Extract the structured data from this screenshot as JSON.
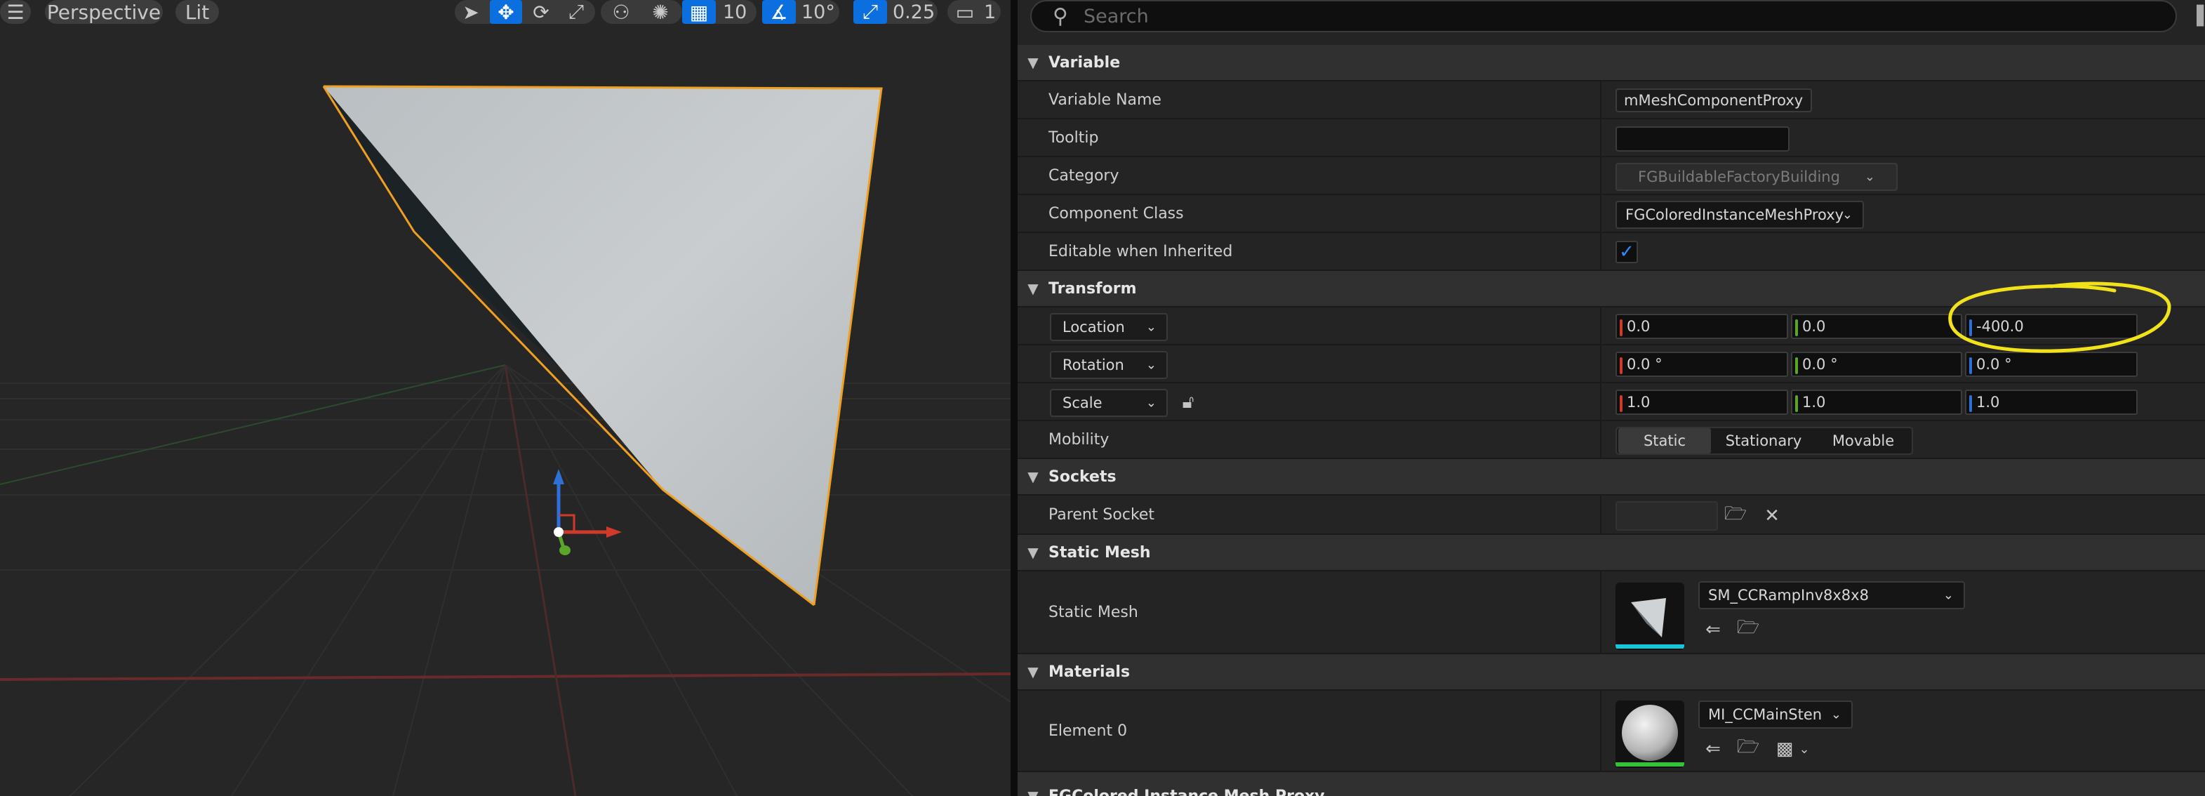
{
  "viewport": {
    "view_mode": "Perspective",
    "lighting_mode": "Lit",
    "grid_snap_value": "10",
    "angle_snap_value": "10°",
    "scale_snap_value": "0.25",
    "camera_speed": "1",
    "icons": [
      "hamburger-menu-icon",
      "select-mode-icon",
      "translate-mode-icon",
      "rotate-mode-icon",
      "scale-mode-icon",
      "surface-snap-icon",
      "world-local-icon",
      "grid-snap-icon",
      "angle-snap-icon",
      "scale-snap-icon",
      "camera-speed-icon"
    ]
  },
  "details": {
    "search_placeholder": "Search",
    "categories": {
      "variable": "Variable",
      "transform": "Transform",
      "sockets": "Sockets",
      "static_mesh": "Static Mesh",
      "materials": "Materials",
      "next": "FGColored Instance Mesh Proxy"
    },
    "variable_name_label": "Variable Name",
    "variable_name_value": "mMeshComponentProxy",
    "tooltip_label": "Tooltip",
    "tooltip_value": "",
    "category_label": "Category",
    "category_value": "FGBuildableFactoryBuilding",
    "component_class_label": "Component Class",
    "component_class_value": "FGColoredInstanceMeshProxy",
    "editable_label": "Editable when Inherited",
    "editable_checked": true,
    "location_label": "Location",
    "location": {
      "x": "0.0",
      "y": "0.0",
      "z": "-400.0"
    },
    "rotation_label": "Rotation",
    "rotation": {
      "x": "0.0 °",
      "y": "0.0 °",
      "z": "0.0 °"
    },
    "scale_label": "Scale",
    "scale": {
      "x": "1.0",
      "y": "1.0",
      "z": "1.0"
    },
    "mobility_label": "Mobility",
    "mobility_options": [
      "Static",
      "Stationary",
      "Movable"
    ],
    "mobility_selected": "Static",
    "parent_socket_label": "Parent Socket",
    "parent_socket_value": "",
    "static_mesh_label": "Static Mesh",
    "static_mesh_value": "SM_CCRampInv8x8x8",
    "element0_label": "Element 0",
    "element0_value": "MI_CCMainSten"
  },
  "colors": {
    "accent_blue": "#0b6fe0",
    "axis_x": "#d03a2a",
    "axis_y": "#5aa52a",
    "axis_z": "#2f6fd8",
    "selection_outline": "#f0a020",
    "annotation": "#f2e21a"
  }
}
